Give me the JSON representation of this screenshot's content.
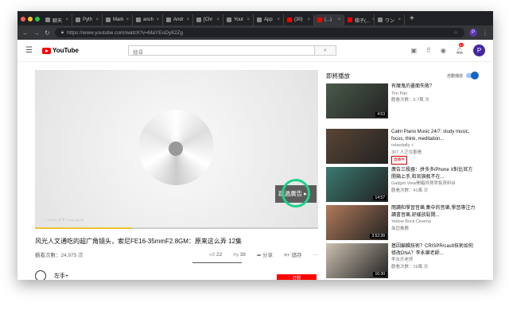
{
  "browser": {
    "tabs": [
      {
        "label": "聊天"
      },
      {
        "label": "Pyth"
      },
      {
        "label": "Mark"
      },
      {
        "label": "anch"
      },
      {
        "label": "Andr"
      },
      {
        "label": "[Chr"
      },
      {
        "label": "Yout"
      },
      {
        "label": "App"
      },
      {
        "label": "(30)"
      },
      {
        "label": "(...)"
      },
      {
        "label": "梯子(..."
      },
      {
        "label": "ワン"
      }
    ],
    "url": "https://www.youtube.com/watch?v=MaYEoDy82Zg"
  },
  "header": {
    "logo": "YouTube",
    "search_placeholder": "搜尋",
    "notifications": "9+",
    "avatar": "P"
  },
  "video": {
    "watermark": "— 2019 / 左手+ Sony Alpha",
    "skip_label": "跳過廣告 ▸",
    "progress": 0.34,
    "title": "风光人文通吃的超广角镜头，索尼FE16-35mmF2.8GM：原来这么弄 12集",
    "views": "觀看次數：24,975 次",
    "likes": "22",
    "dislikes": "38",
    "share": "分享",
    "save": "儲存",
    "more": "···",
    "channel": "左手+",
    "subscribe": "訂閱"
  },
  "sidebar": {
    "heading": "即將播放",
    "autoplay": "自動播放",
    "items": [
      {
        "title": "有魔鬼的畫面失敗？",
        "channel": "Tim Pan",
        "meta": "觀看次數：5.7萬 次",
        "duration": "4:53",
        "color": "#4a5a4a"
      },
      {
        "title": "Calm Piano Music 24/7: study music, focus, think, meditation...",
        "channel": "relaxdaily ✓",
        "meta": "307 人正在觀看",
        "badge": "直播中",
        "duration": "",
        "color": "#5a4535"
      },
      {
        "title": "廣告三殺器：拼多多iPhone X對比官方開箱上手,和官旗舰不在...",
        "channel": "Gadget View開箱評測零售資料台",
        "meta": "觀看次數：41萬 次",
        "duration": "14:57",
        "color": "#3a7a70"
      },
      {
        "title": "閱讀和學習音樂,集中的音樂,學習專注力讀書音樂,舒緩放鬆開...",
        "channel": "Yellow Brick Cinema",
        "meta": "為您推薦",
        "duration": "3:52:38",
        "color": "#b07a5a"
      },
      {
        "title": "基因編輯技術？CRISPR/cas9技術如何修改DNA？李永樂老師...",
        "channel": "李永乐老师",
        "meta": "觀看次數：19萬 次",
        "duration": "16:30",
        "color": "#ccc0b0"
      }
    ]
  }
}
